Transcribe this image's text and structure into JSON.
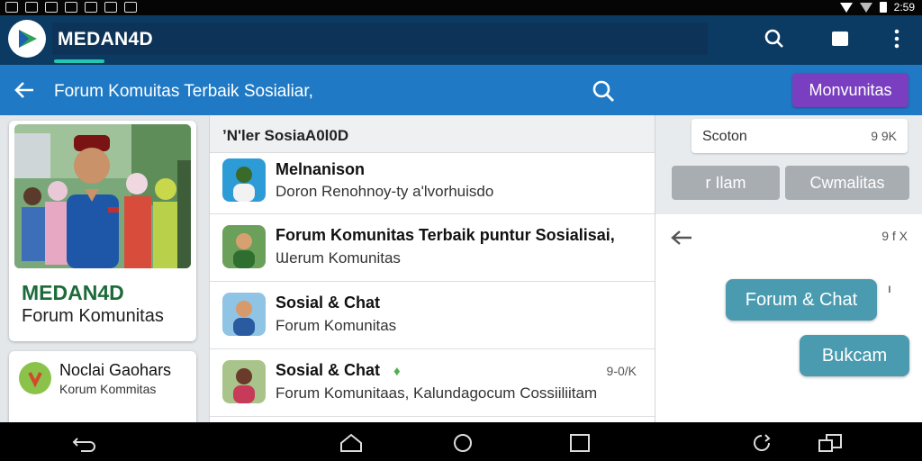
{
  "status_bar": {
    "time": "2:59"
  },
  "app_bar": {
    "title": "MEDAN4D"
  },
  "sub_bar": {
    "title": "Forum Komuitas Terbaik Sosialiar,",
    "action_button": "Monvunitas"
  },
  "profile_card": {
    "brand": "MEDAN4D",
    "subtitle": "Forum Komunitas"
  },
  "mini_card": {
    "title": "Noclai Gaohars",
    "subtitle": "Korum Kommitas"
  },
  "list": {
    "header": "ʼN'ler SosiaA0l0D",
    "rows": [
      {
        "title": "Melnanison",
        "subtitle": "Doron Renohnoy-ty a'lvorhuisdo",
        "meta": ""
      },
      {
        "title": "Forum Komunitas Terbaik puntur Sosialisai,",
        "subtitle": "Ɯerum Komunitas",
        "meta": ""
      },
      {
        "title": "Sosial & Chat",
        "subtitle": "Forum Komunitas",
        "meta": ""
      },
      {
        "title": "Sosial & Chat",
        "subtitle": "Forum Komunitaas, Kalundagocum Cossiiliitam",
        "meta": "9-0/K"
      }
    ]
  },
  "right_panel": {
    "search": {
      "text": "Scoton",
      "meta": "9 9K"
    },
    "chips": [
      "r Ilam",
      "Cwmalitas"
    ],
    "chat": {
      "meta": "9 f X",
      "bubbles": [
        "Forum & Chat",
        "Bukcam"
      ],
      "marker": "ı"
    }
  },
  "colors": {
    "app_bar": "#0b3a63",
    "sub_bar": "#1f79c4",
    "accent": "#7a3fc0",
    "teal": "#25c6b0",
    "bubble": "#4a9bb0"
  }
}
